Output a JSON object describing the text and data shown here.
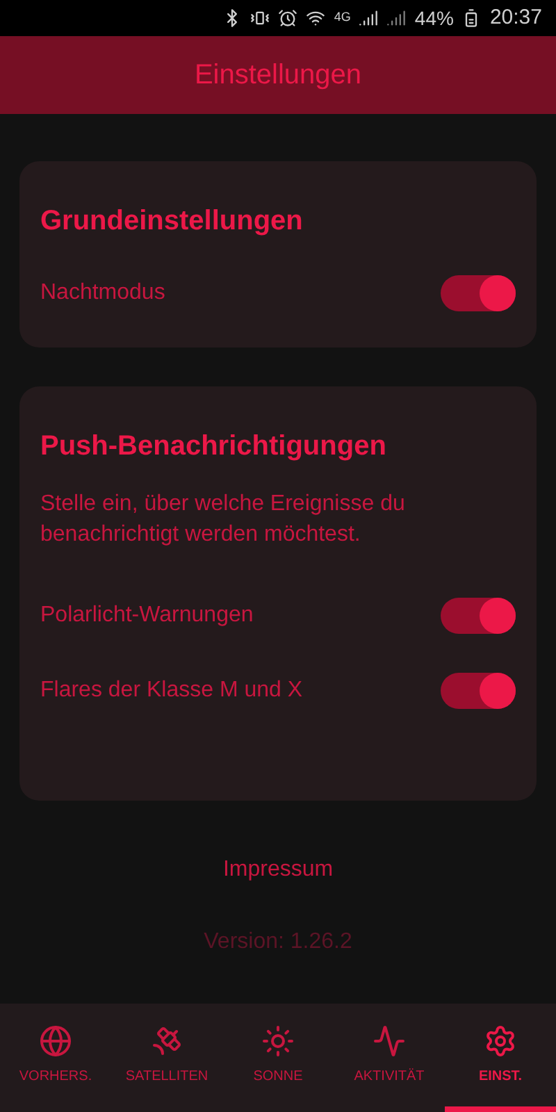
{
  "status_bar": {
    "network": "4G",
    "battery": "44%",
    "time": "20:37"
  },
  "header": {
    "title": "Einstellungen"
  },
  "sections": [
    {
      "title": "Grundeinstellungen",
      "settings": [
        {
          "label": "Nachtmodus",
          "on": true
        }
      ]
    },
    {
      "title": "Push-Benachrichtigungen",
      "description": "Stelle ein, über welche Ereignisse du benachrichtigt werden möchtest.",
      "settings": [
        {
          "label": "Polarlicht-Warnungen",
          "on": true
        },
        {
          "label": "Flares der Klasse M und X",
          "on": true
        }
      ]
    }
  ],
  "impressum": "Impressum",
  "version": "Version: 1.26.2",
  "tabs": [
    {
      "label": "VORHERS.",
      "kind": "globe",
      "selected": false
    },
    {
      "label": "SATELLITEN",
      "kind": "satellite",
      "selected": false
    },
    {
      "label": "SONNE",
      "kind": "sun",
      "selected": false
    },
    {
      "label": "AKTIVITÄT",
      "kind": "activity",
      "selected": false
    },
    {
      "label": "EINST.",
      "kind": "settings",
      "selected": true
    }
  ]
}
